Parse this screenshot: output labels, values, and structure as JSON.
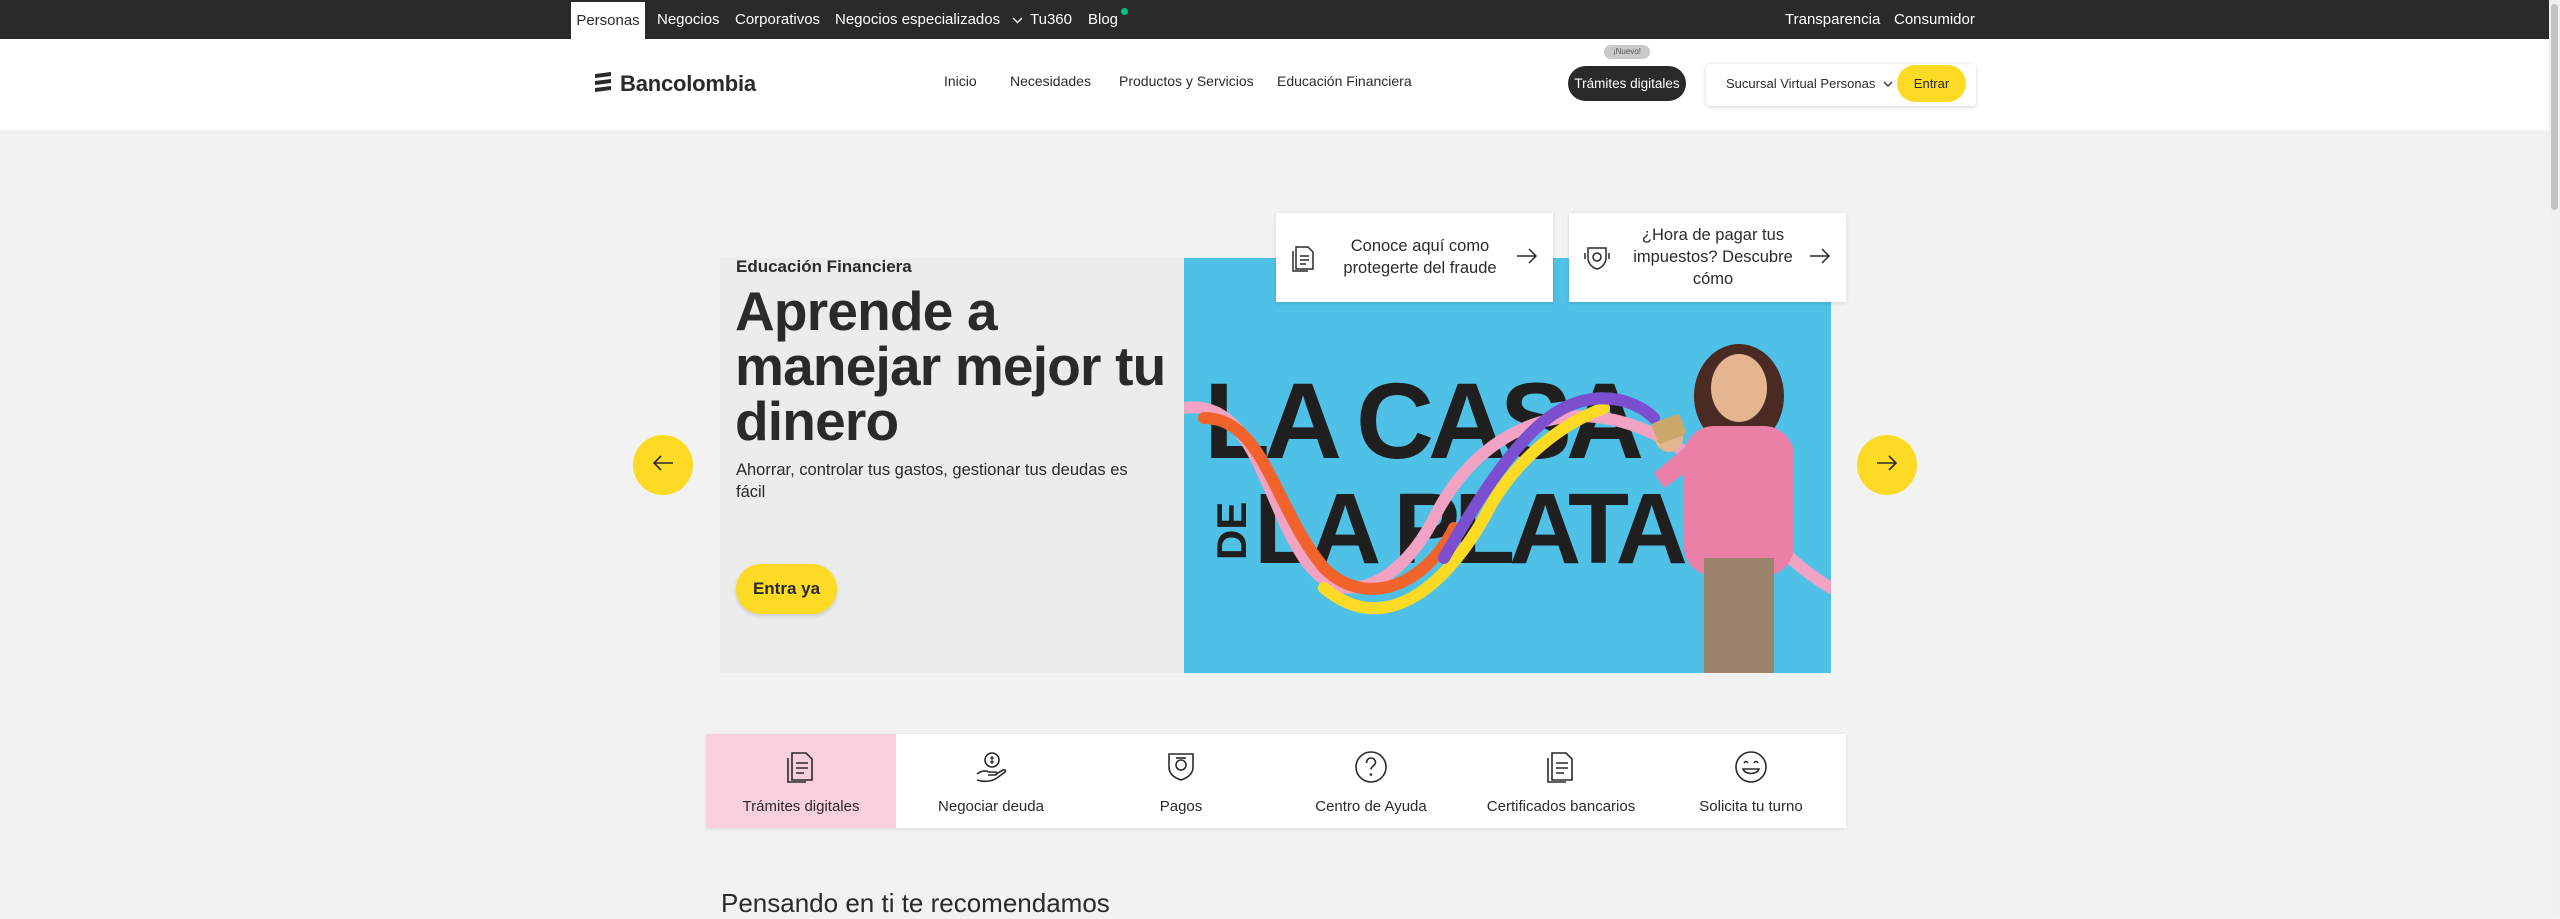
{
  "topbar": {
    "items": [
      "Personas",
      "Negocios",
      "Corporativos",
      "Negocios especializados",
      "Tu360",
      "Blog"
    ],
    "right": [
      "Transparencia",
      "Consumidor"
    ]
  },
  "header": {
    "brand": "Bancolombia",
    "nav": [
      "Inicio",
      "Necesidades",
      "Productos y Servicios",
      "Educación Financiera"
    ],
    "tramites": "Trámites digitales",
    "badge": "¡Nuevo!",
    "sucursal": "Sucursal Virtual Personas",
    "entrar": "Entrar"
  },
  "hero": {
    "eyebrow": "Educación Financiera",
    "title": "Aprende a manejar mejor tu dinero",
    "description": "Ahorrar, controlar tus gastos, gestionar tus deudas es fácil",
    "cta": "Entra ya",
    "image_text_1": "LA CASA",
    "image_text_2": "DE",
    "image_text_3": "LA PLATA"
  },
  "cards": [
    {
      "text": "Conoce aquí como protegerte del fraude",
      "icon": "document-icon"
    },
    {
      "text": "¿Hora de pagar tus impuestos? Descubre cómo",
      "icon": "tax-icon"
    }
  ],
  "quick_access": [
    {
      "label": "Trámites digitales",
      "icon": "document-icon",
      "active": true
    },
    {
      "label": "Negociar deuda",
      "icon": "money-hand-icon"
    },
    {
      "label": "Pagos",
      "icon": "payment-icon"
    },
    {
      "label": "Centro de Ayuda",
      "icon": "question-icon"
    },
    {
      "label": "Certificados bancarios",
      "icon": "certificate-icon"
    },
    {
      "label": "Solicita tu turno",
      "icon": "smile-icon"
    }
  ],
  "recommend_title": "Pensando en ti te recomendamos",
  "colors": {
    "accent": "#fdda24",
    "dark": "#2c2a29",
    "hero_bg": "#4fc0e6",
    "active_tab": "#f8cfdc"
  }
}
